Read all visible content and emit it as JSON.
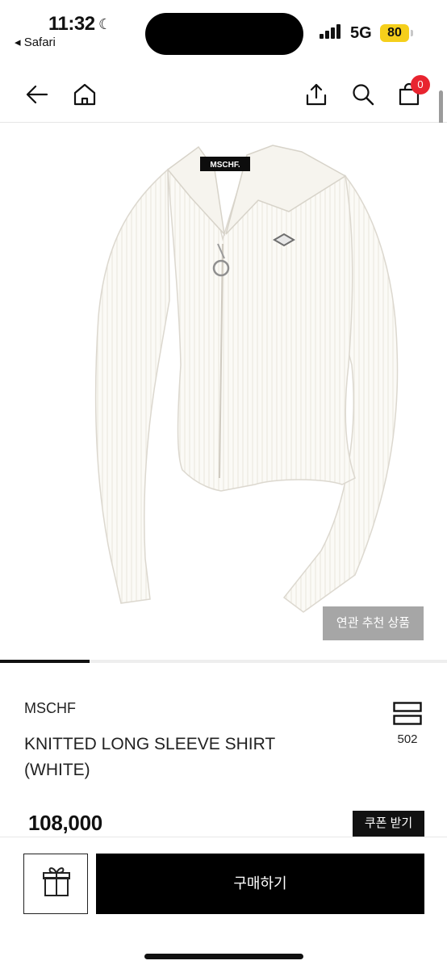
{
  "status_bar": {
    "time": "11:32",
    "back_app": "◂ Safari",
    "network": "5G",
    "battery": "80"
  },
  "nav": {
    "back_icon": "arrow-left-icon",
    "home_icon": "home-icon",
    "share_icon": "share-icon",
    "search_icon": "search-icon",
    "cart_icon": "shopping-bag-icon",
    "cart_count": "0"
  },
  "hero": {
    "label_tag": "MSCHF.",
    "related_button": "연관 추천 상품",
    "image_progress": 0.2
  },
  "product": {
    "brand": "MSCHF",
    "title_line1": "KNITTED LONG SLEEVE SHIRT",
    "title_line2": "(WHITE)",
    "like_icon": "bookmark-icon",
    "like_count": "502",
    "price": "108,000",
    "coupon_button": "쿠폰 받기"
  },
  "bottom_bar": {
    "gift_icon": "gift-icon",
    "buy_button": "구매하기"
  },
  "colors": {
    "badge": "#e8242f",
    "battery": "#f5cf1b",
    "related_bg": "#a6a6a6",
    "primary": "#000000"
  }
}
